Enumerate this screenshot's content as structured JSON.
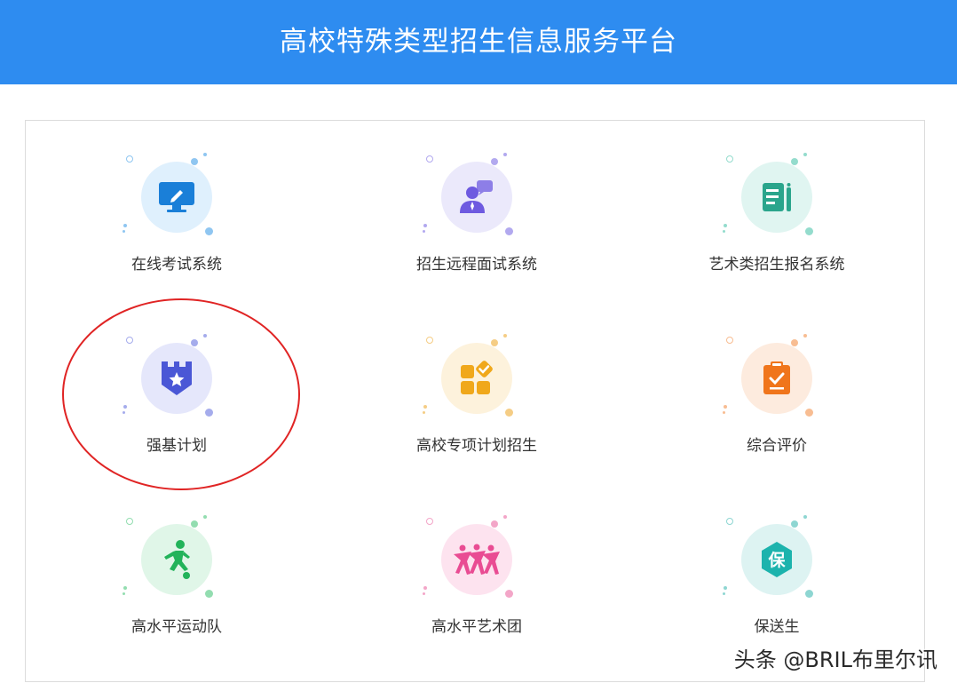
{
  "header": {
    "title": "高校特殊类型招生信息服务平台",
    "bg_color": "#2e8cf0"
  },
  "services": [
    {
      "label": "在线考试系统",
      "icon": "monitor-pen-icon",
      "circle_color": "#dff0fd",
      "dot_color": "#8fc6f1",
      "icon_color": "#1a7fd8"
    },
    {
      "label": "招生远程面试系统",
      "icon": "interview-user-icon",
      "circle_color": "#ebe9fb",
      "dot_color": "#b2a9ef",
      "icon_color": "#6e5ae0"
    },
    {
      "label": "艺术类招生报名系统",
      "icon": "document-list-icon",
      "circle_color": "#e0f5f1",
      "dot_color": "#94dccd",
      "icon_color": "#2aa58c"
    },
    {
      "label": "强基计划",
      "icon": "shield-star-icon",
      "circle_color": "#e5e7fb",
      "dot_color": "#a5acec",
      "icon_color": "#4a57d6"
    },
    {
      "label": "高校专项计划招生",
      "icon": "grid-check-icon",
      "circle_color": "#fdf2dc",
      "dot_color": "#f5cd85",
      "icon_color": "#f0a81b"
    },
    {
      "label": "综合评价",
      "icon": "clipboard-check-icon",
      "circle_color": "#fdebde",
      "dot_color": "#f8bd92",
      "icon_color": "#f0751b"
    },
    {
      "label": "高水平运动队",
      "icon": "soccer-player-icon",
      "circle_color": "#e0f6e8",
      "dot_color": "#93ddb0",
      "icon_color": "#22b35a"
    },
    {
      "label": "高水平艺术团",
      "icon": "dancers-icon",
      "circle_color": "#fde3ef",
      "dot_color": "#f3a6c8",
      "icon_color": "#e94c93"
    },
    {
      "label": "保送生",
      "icon": "bao-badge-icon",
      "circle_color": "#ddf3f2",
      "dot_color": "#8ed6d2",
      "icon_color": "#1cb3ad",
      "badge_text": "保"
    }
  ],
  "watermark": "头条 @BRIL布里尔讯"
}
